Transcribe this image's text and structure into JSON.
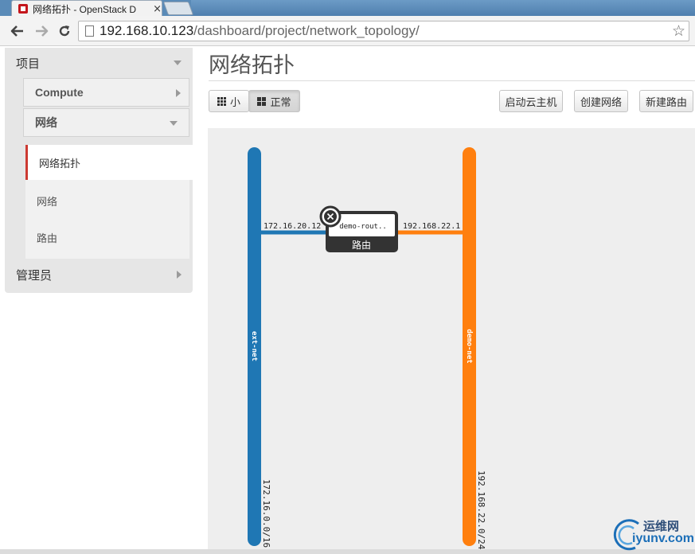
{
  "browser": {
    "tab_title": "网络拓扑 - OpenStack D",
    "tab_close": "×",
    "url_host": "192.168.10.123",
    "url_path": "/dashboard/project/network_topology/"
  },
  "sidebar": {
    "project_label": "项目",
    "compute_label": "Compute",
    "network_group_label": "网络",
    "links": [
      {
        "label": "网络拓扑",
        "active": true
      },
      {
        "label": "网络",
        "active": false
      },
      {
        "label": "路由",
        "active": false
      }
    ],
    "admin_label": "管理员"
  },
  "page": {
    "title": "网络拓扑",
    "view_small_label": "小",
    "view_normal_label": "正常",
    "launch_instance_label": "启动云主机",
    "create_network_label": "创建网络",
    "create_router_label": "新建路由"
  },
  "topology": {
    "networks": [
      {
        "name": "ext-net",
        "cidr": "172.16.0.0/16",
        "color": "#1f77b4"
      },
      {
        "name": "demo-net",
        "cidr": "192.168.22.0/24",
        "color": "#ff7f0e"
      }
    ],
    "router": {
      "name": "demo-rout..",
      "type_label": "路由",
      "ports": [
        {
          "network": "ext-net",
          "ip": "172.16.20.12"
        },
        {
          "network": "demo-net",
          "ip": "192.168.22.1"
        }
      ]
    }
  },
  "watermark": {
    "line1": "运维网",
    "line2": "iyunv.com"
  }
}
